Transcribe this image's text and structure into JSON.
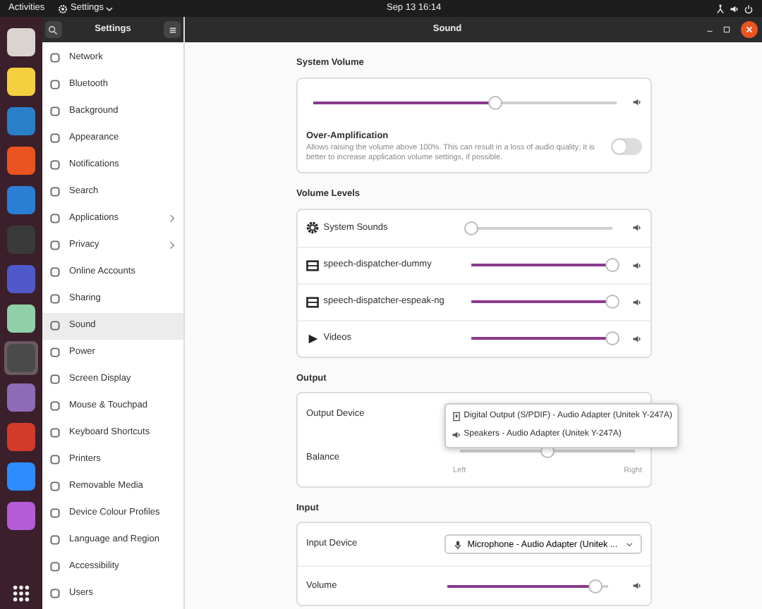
{
  "top_bar": {
    "activities": "Activities",
    "app_menu": "Settings",
    "clock": "Sep 13  16:14"
  },
  "dock": [
    {
      "color": "#d9d4cf",
      "selected": false
    },
    {
      "color": "#f4d03f",
      "selected": false
    },
    {
      "color": "#2a7fc9",
      "selected": false
    },
    {
      "color": "#e95420",
      "selected": false
    },
    {
      "color": "#2a7fd4",
      "selected": false
    },
    {
      "color": "#3a3a3a",
      "selected": false
    },
    {
      "color": "#5059c9",
      "selected": false
    },
    {
      "color": "#8fd0a8",
      "selected": false
    },
    {
      "color": "#4a4a4a",
      "selected": true
    },
    {
      "color": "#8e6bb5",
      "selected": false
    },
    {
      "color": "#d23a2a",
      "selected": false
    },
    {
      "color": "#2d8cff",
      "selected": false
    },
    {
      "color": "#b45bd6",
      "selected": false
    }
  ],
  "sidebar": {
    "title": "Settings",
    "items": [
      {
        "label": "Network",
        "arrow": false,
        "selected": false
      },
      {
        "label": "Bluetooth",
        "arrow": false,
        "selected": false
      },
      {
        "label": "Background",
        "arrow": false,
        "selected": false
      },
      {
        "label": "Appearance",
        "arrow": false,
        "selected": false
      },
      {
        "label": "Notifications",
        "arrow": false,
        "selected": false
      },
      {
        "label": "Search",
        "arrow": false,
        "selected": false
      },
      {
        "label": "Applications",
        "arrow": true,
        "selected": false
      },
      {
        "label": "Privacy",
        "arrow": true,
        "selected": false
      },
      {
        "label": "Online Accounts",
        "arrow": false,
        "selected": false
      },
      {
        "label": "Sharing",
        "arrow": false,
        "selected": false
      },
      {
        "label": "Sound",
        "arrow": false,
        "selected": true
      },
      {
        "label": "Power",
        "arrow": false,
        "selected": false
      },
      {
        "label": "Screen Display",
        "arrow": false,
        "selected": false
      },
      {
        "label": "Mouse & Touchpad",
        "arrow": false,
        "selected": false
      },
      {
        "label": "Keyboard Shortcuts",
        "arrow": false,
        "selected": false
      },
      {
        "label": "Printers",
        "arrow": false,
        "selected": false
      },
      {
        "label": "Removable Media",
        "arrow": false,
        "selected": false
      },
      {
        "label": "Device Colour Profiles",
        "arrow": false,
        "selected": false
      },
      {
        "label": "Language and Region",
        "arrow": false,
        "selected": false
      },
      {
        "label": "Accessibility",
        "arrow": false,
        "selected": false
      },
      {
        "label": "Users",
        "arrow": false,
        "selected": false
      }
    ]
  },
  "window": {
    "title": "Sound"
  },
  "system_volume": {
    "heading": "System Volume",
    "level": 0.6,
    "over_amplification": {
      "title": "Over-Amplification",
      "description": "Allows raising the volume above 100%. This can result in a loss of audio quality; it is better to increase application volume settings, if possible.",
      "on": false
    }
  },
  "volume_levels": {
    "heading": "Volume Levels",
    "streams": [
      {
        "kind": "gear",
        "label": "System Sounds",
        "level": 0
      },
      {
        "kind": "film",
        "label": "speech-dispatcher-dummy",
        "level": 1
      },
      {
        "kind": "film",
        "label": "speech-dispatcher-espeak-ng",
        "level": 1
      },
      {
        "kind": "play",
        "label": "Videos",
        "level": 1
      }
    ]
  },
  "output": {
    "heading": "Output",
    "device_label": "Output Device",
    "balance_label": "Balance",
    "balance": {
      "level": 0.5,
      "left": "Left",
      "right": "Right"
    },
    "menu": [
      {
        "kind": "digital",
        "label": "Digital Output (S/PDIF) - Audio Adapter (Unitek Y-247A)"
      },
      {
        "kind": "speaker",
        "label": "Speakers - Audio Adapter (Unitek Y-247A)"
      }
    ]
  },
  "input": {
    "heading": "Input",
    "device_label": "Input Device",
    "device": "Microphone - Audio Adapter (Unitek ...",
    "volume_label": "Volume",
    "level": 0.92
  }
}
